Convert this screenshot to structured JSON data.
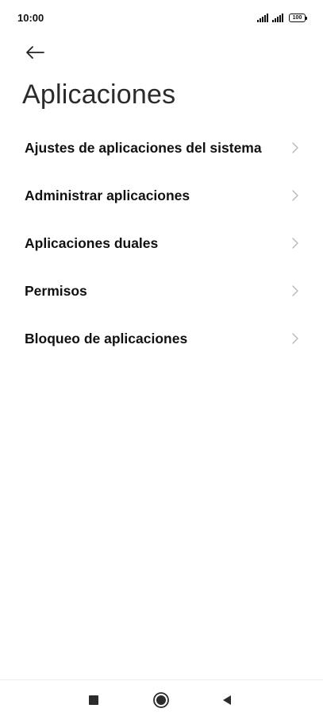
{
  "status_bar": {
    "time": "10:00",
    "battery": "100"
  },
  "header": {
    "back_icon": "arrow-left-icon",
    "title": "Aplicaciones"
  },
  "menu": {
    "items": [
      {
        "label": "Ajustes de aplicaciones del sistema",
        "icon": "chevron-right-icon"
      },
      {
        "label": "Administrar aplicaciones",
        "icon": "chevron-right-icon"
      },
      {
        "label": "Aplicaciones duales",
        "icon": "chevron-right-icon"
      },
      {
        "label": "Permisos",
        "icon": "chevron-right-icon"
      },
      {
        "label": "Bloqueo de aplicaciones",
        "icon": "chevron-right-icon"
      }
    ]
  },
  "nav_bar": {
    "recents_icon": "square-icon",
    "home_icon": "circle-icon",
    "back_icon": "triangle-back-icon"
  },
  "colors": {
    "background": "#ffffff",
    "text": "#111111",
    "title": "#2b2b2b",
    "chevron": "#b5b5b5",
    "nav_icon": "#2b2b2b"
  }
}
